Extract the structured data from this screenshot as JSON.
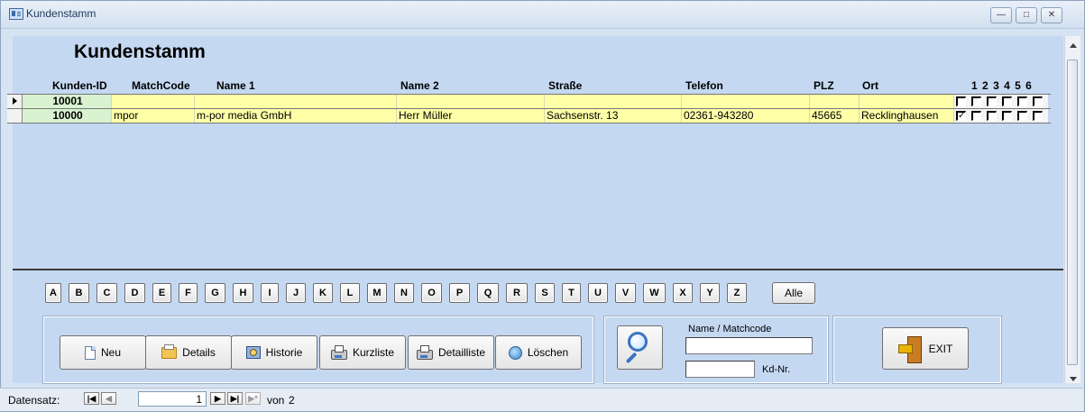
{
  "window": {
    "title": "Kundenstamm",
    "controls": [
      "minimize",
      "restore",
      "close"
    ]
  },
  "form": {
    "title": "Kundenstamm"
  },
  "columns": {
    "kunden_id": "Kunden-ID",
    "matchcode": "MatchCode",
    "name1": "Name 1",
    "name2": "Name 2",
    "strasse": "Straße",
    "telefon": "Telefon",
    "plz": "PLZ",
    "ort": "Ort",
    "check_numbers": [
      "1",
      "2",
      "3",
      "4",
      "5",
      "6"
    ]
  },
  "rows": [
    {
      "kunden_id": "10001",
      "matchcode": "",
      "name1": "",
      "name2": "",
      "strasse": "",
      "telefon": "",
      "plz": "",
      "ort": "",
      "checks": [
        false,
        false,
        false,
        false,
        false,
        false
      ]
    },
    {
      "kunden_id": "10000",
      "matchcode": "mpor",
      "name1": "m-por media GmbH",
      "name2": "Herr Müller",
      "strasse": "Sachsenstr. 13",
      "telefon": "02361-943280",
      "plz": "45665",
      "ort": "Recklinghausen",
      "checks": [
        true,
        false,
        false,
        false,
        false,
        false
      ]
    }
  ],
  "alphabet": [
    "A",
    "B",
    "C",
    "D",
    "E",
    "F",
    "G",
    "H",
    "I",
    "J",
    "K",
    "L",
    "M",
    "N",
    "O",
    "P",
    "Q",
    "R",
    "S",
    "T",
    "U",
    "V",
    "W",
    "X",
    "Y",
    "Z"
  ],
  "alle_label": "Alle",
  "actions": {
    "neu": "Neu",
    "details": "Details",
    "historie": "Historie",
    "kurzliste": "Kurzliste",
    "detailliste": "Detailliste",
    "loeschen": "Löschen"
  },
  "search": {
    "name_label": "Name / Matchcode",
    "name_value": "",
    "kdnr_label": "Kd-Nr.",
    "kdnr_value": ""
  },
  "exit_label": "EXIT",
  "navigation": {
    "label": "Datensatz:",
    "current": "1",
    "of_label": "von",
    "total": "2"
  }
}
